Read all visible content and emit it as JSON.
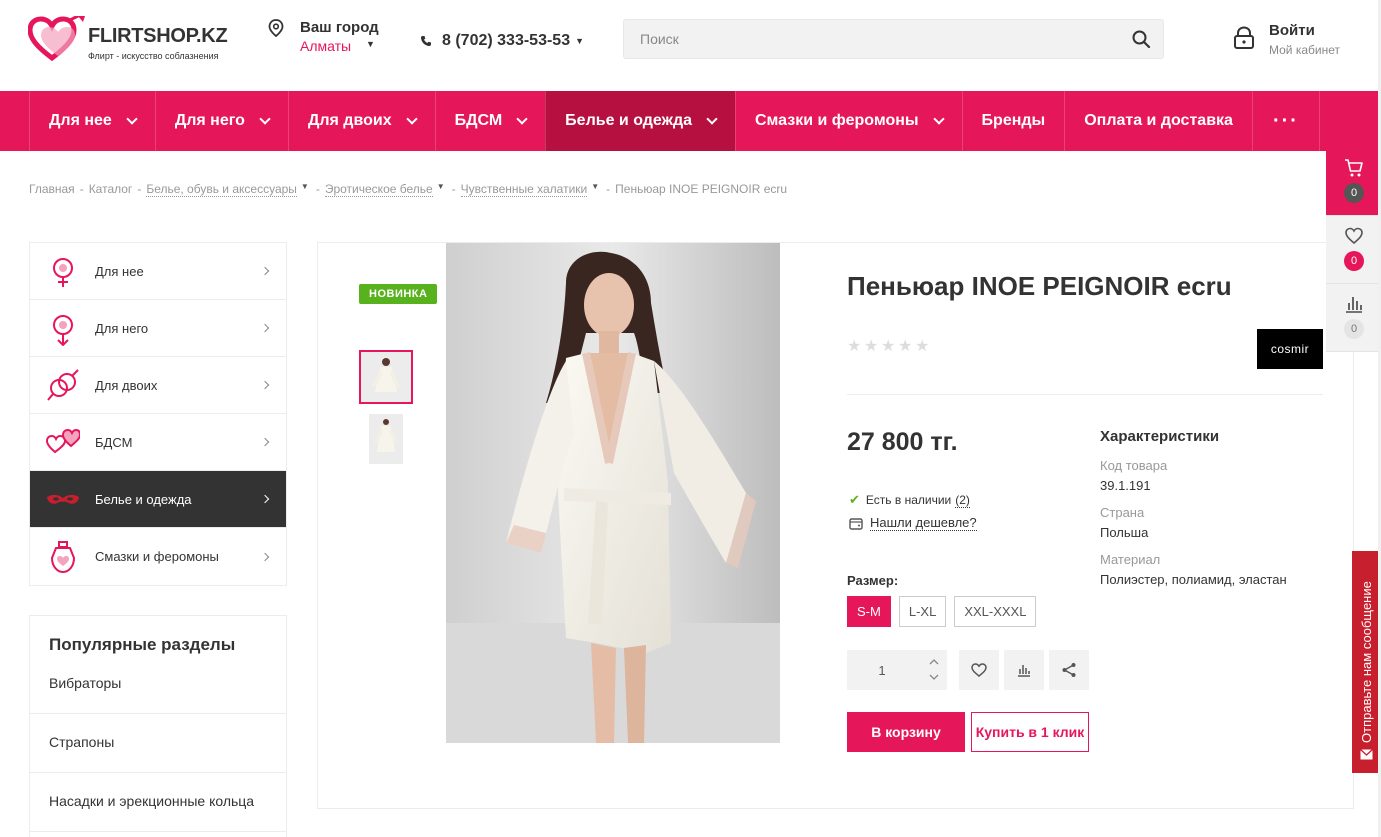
{
  "header": {
    "logo_text": "FLIRTSHOP.KZ",
    "logo_sub": "Флирт - искусство соблазнения",
    "city_label": "Ваш город",
    "city_value": "Алматы",
    "phone": "8 (702) 333-53-53",
    "search_placeholder": "Поиск",
    "login_title": "Войти",
    "login_sub": "Мой кабинет"
  },
  "nav": {
    "items": [
      {
        "label": "Для нее"
      },
      {
        "label": "Для него"
      },
      {
        "label": "Для двоих"
      },
      {
        "label": "БДСМ"
      },
      {
        "label": "Белье и одежда"
      },
      {
        "label": "Смазки и феромоны"
      },
      {
        "label": "Бренды"
      },
      {
        "label": "Оплата и доставка"
      }
    ],
    "more": "···"
  },
  "breadcrumb": {
    "items": [
      "Главная",
      "Каталог",
      "Белье, обувь и аксессуары",
      "Эротическое белье",
      "Чувственные халатики",
      "Пеньюар INOE PEIGNOIR ecru"
    ],
    "sep": "-"
  },
  "sidebar": {
    "items": [
      {
        "label": "Для нее"
      },
      {
        "label": "Для него"
      },
      {
        "label": "Для двоих"
      },
      {
        "label": "БДСМ"
      },
      {
        "label": "Белье и одежда"
      },
      {
        "label": "Смазки и феромоны"
      }
    ],
    "popular_title": "Популярные разделы",
    "popular": [
      "Вибраторы",
      "Страпоны",
      "Насадки и эрекционные кольца"
    ]
  },
  "product": {
    "badge": "НОВИНКА",
    "title": "Пеньюар INOE PEIGNOIR ecru",
    "brand": "cosmir",
    "price": "27 800 тг.",
    "stock": "Есть в наличии",
    "stock_count": "(2)",
    "cheaper": "Нашли дешевле?",
    "size_label": "Размер:",
    "sizes": [
      "S-M",
      "L-XL",
      "XXL-XXXL"
    ],
    "quantity": "1",
    "cart_button": "В корзину",
    "oneclick_button": "Купить в 1 клик",
    "chars_title": "Характеристики",
    "chars": [
      {
        "label": "Код товара",
        "value": "39.1.191"
      },
      {
        "label": "Страна",
        "value": "Польша"
      },
      {
        "label": "Материал",
        "value": "Полиэстер, полиамид, эластан"
      }
    ],
    "rating_filled_of_5": 0
  },
  "float_panel": {
    "cart_count": "0",
    "fav_count": "0",
    "compare_count": "0"
  },
  "feedback": "Отправьте нам сообщение",
  "colors": {
    "accent": "#e6165b",
    "nav_active": "#b5103f",
    "dark": "#333333",
    "success": "#58b21e",
    "feedback": "#c81f2e"
  }
}
